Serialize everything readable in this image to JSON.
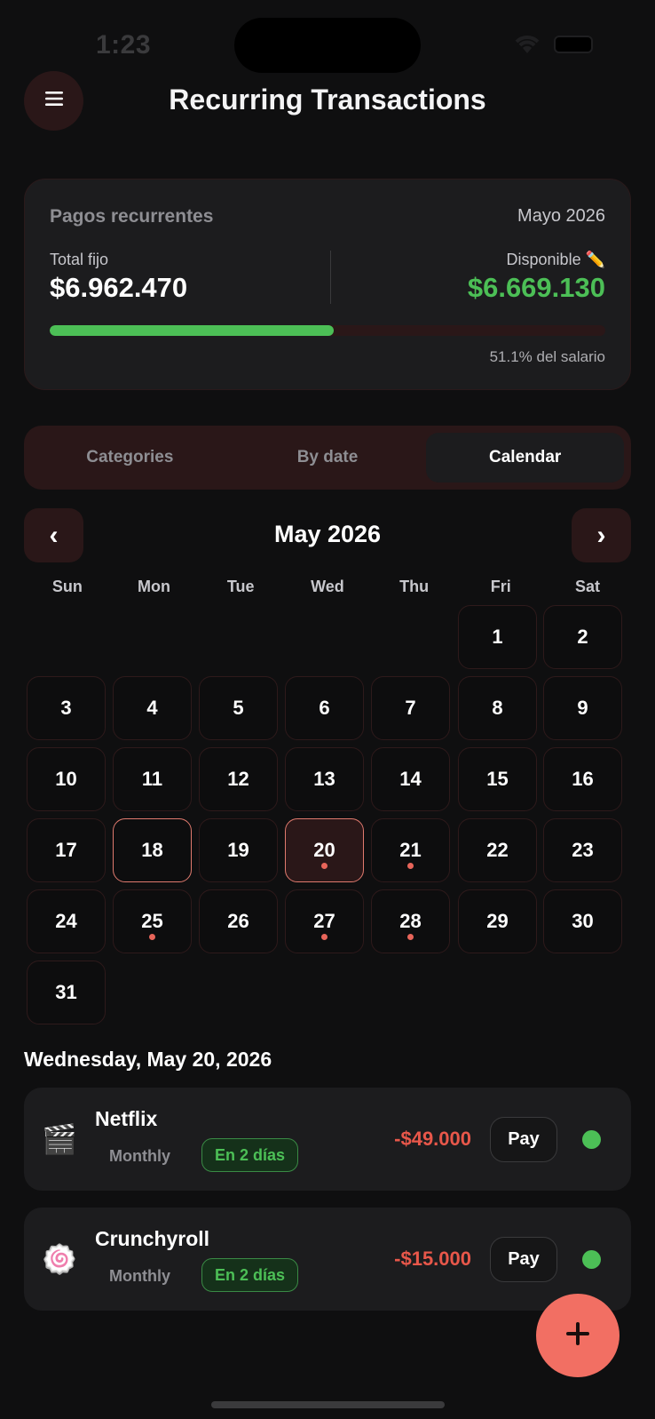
{
  "status_bar": {
    "time": "1:23"
  },
  "header": {
    "title": "Recurring Transactions",
    "menu_icon": "hamburger-menu-icon"
  },
  "summary": {
    "label": "Pagos recurrentes",
    "month": "Mayo 2026",
    "fixed_label": "Total fijo",
    "fixed_value": "$6.962.470",
    "available_label": "Disponible ✏️",
    "available_value": "$6.669.130",
    "progress_fraction": 0.511,
    "progress_text": "51.1% del salario",
    "colors": {
      "accent_green": "#4cbf56",
      "track": "#2a1718"
    }
  },
  "tabs": [
    {
      "label": "Categories",
      "active": false
    },
    {
      "label": "By date",
      "active": false
    },
    {
      "label": "Calendar",
      "active": true
    }
  ],
  "calendar": {
    "title": "May 2026",
    "prev_label": "‹",
    "next_label": "›",
    "weekdays": [
      "Sun",
      "Mon",
      "Tue",
      "Wed",
      "Thu",
      "Fri",
      "Sat"
    ],
    "first_weekday_index": 5,
    "days_in_month": 31,
    "today": 18,
    "selected": 20,
    "days_with_transactions": [
      20,
      21,
      25,
      27,
      28
    ]
  },
  "selected_date_heading": "Wednesday, May 20, 2026",
  "transactions": [
    {
      "icon": "🎬",
      "icon_name": "clapper-board-icon",
      "name": "Netflix",
      "frequency": "Monthly",
      "badge": "En 2 días",
      "amount": "-$49.000",
      "pay_label": "Pay"
    },
    {
      "icon": "🍥",
      "icon_name": "fish-cake-icon",
      "name": "Crunchyroll",
      "frequency": "Monthly",
      "badge": "En 2 días",
      "amount": "-$15.000",
      "pay_label": "Pay"
    }
  ],
  "fab": {
    "icon": "plus-icon",
    "color": "#f26f63"
  }
}
